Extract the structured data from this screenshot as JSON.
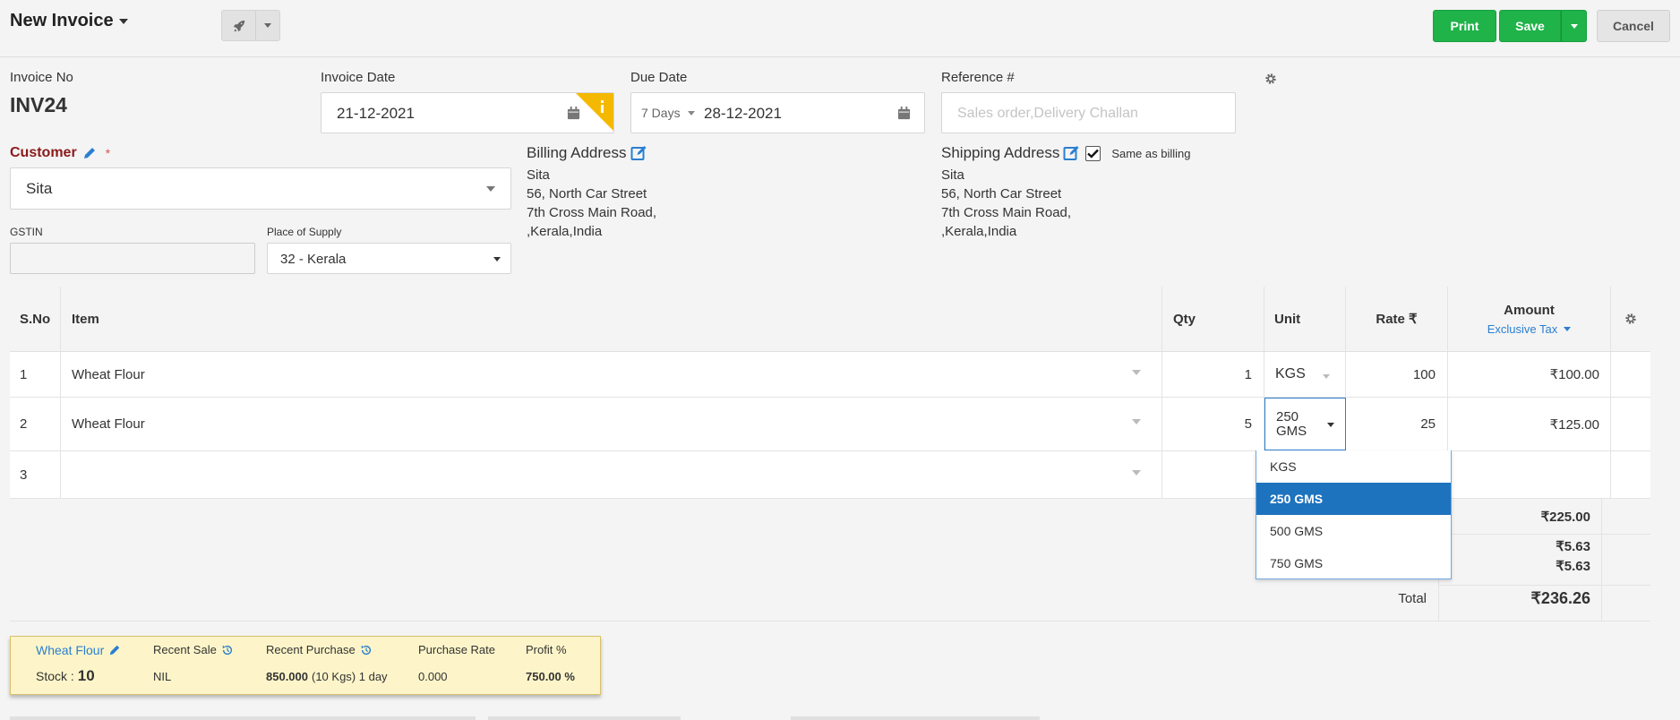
{
  "header": {
    "title": "New Invoice",
    "print_label": "Print",
    "save_label": "Save",
    "cancel_label": "Cancel"
  },
  "invoice": {
    "no_label": "Invoice No",
    "no_value": "INV24",
    "date_label": "Invoice Date",
    "date_value": "21-12-2021",
    "due_label": "Due Date",
    "due_terms": "7 Days",
    "due_value": "28-12-2021",
    "ref_label": "Reference #",
    "ref_placeholder": "Sales order,Delivery Challan"
  },
  "customer": {
    "label": "Customer",
    "required_mark": "*",
    "value": "Sita",
    "gstin_label": "GSTIN",
    "gstin_value": "",
    "pos_label": "Place of Supply",
    "pos_value": "32 - Kerala"
  },
  "billing": {
    "label": "Billing Address",
    "lines": [
      "Sita",
      "56, North Car Street",
      "7th Cross Main Road,",
      ",Kerala,India"
    ]
  },
  "shipping": {
    "label": "Shipping Address",
    "same_label": "Same as billing",
    "same_checked": true,
    "lines": [
      "Sita",
      "56, North Car Street",
      "7th Cross Main Road,",
      ",Kerala,India"
    ]
  },
  "table": {
    "headers": {
      "sno": "S.No",
      "item": "Item",
      "qty": "Qty",
      "unit": "Unit",
      "rate": "Rate ₹",
      "amount": "Amount",
      "tax_mode": "Exclusive Tax"
    },
    "rows": [
      {
        "sno": "1",
        "item": "Wheat Flour",
        "qty": "1",
        "unit": "KGS",
        "rate": "100",
        "amount": "₹100.00"
      },
      {
        "sno": "2",
        "item": "Wheat Flour",
        "qty": "5",
        "unit": "250 GMS",
        "rate": "25",
        "amount": "₹125.00"
      },
      {
        "sno": "3",
        "item": "",
        "qty": "",
        "unit": "",
        "rate": "",
        "amount": ""
      }
    ]
  },
  "unit_dropdown": {
    "options": [
      "KGS",
      "250 GMS",
      "500 GMS",
      "750 GMS"
    ],
    "selected": "250 GMS"
  },
  "totals": {
    "subtotal": "₹225.00",
    "tax1": "₹5.63",
    "tax2": "₹5.63",
    "total_label": "Total",
    "total": "₹236.26"
  },
  "item_panel": {
    "item_name": "Wheat Flour",
    "stock_label": "Stock :",
    "stock_value": "10",
    "recent_sale_label": "Recent Sale",
    "recent_sale_value": "NIL",
    "recent_purchase_label": "Recent Purchase",
    "recent_purchase_value": "850.000",
    "recent_purchase_detail": "(10 Kgs) 1 day",
    "purchase_rate_label": "Purchase Rate",
    "purchase_rate_value": "0.000",
    "profit_label": "Profit %",
    "profit_value": "750.00 %"
  },
  "colors": {
    "green": "#1fb349",
    "accent_blue": "#1e73be",
    "customer_label": "#8b1a1a",
    "panel_bg": "#fdf5c9",
    "warning": "#f5b800"
  }
}
